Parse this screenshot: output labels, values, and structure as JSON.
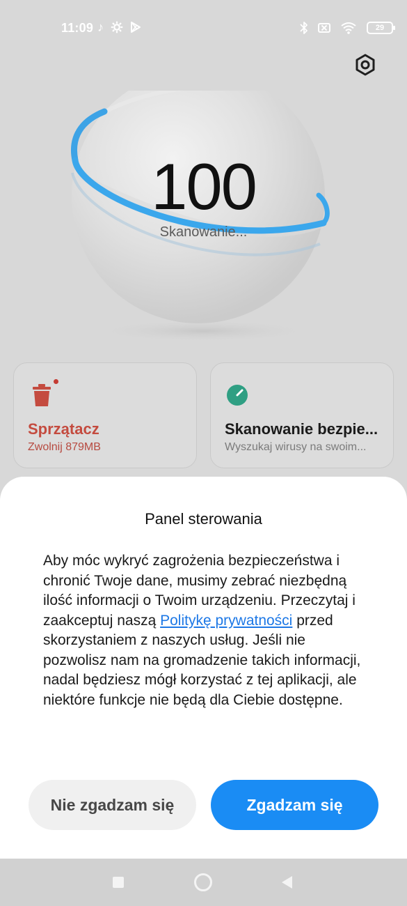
{
  "status_bar": {
    "time": "11:09",
    "left_icons": [
      "tiktok-icon",
      "settings-icon",
      "play-store-icon"
    ],
    "right_icons": [
      "bluetooth-icon",
      "no-sim-icon",
      "wifi-icon"
    ],
    "battery_level": "29"
  },
  "hero": {
    "score": "100",
    "status_text": "Skanowanie..."
  },
  "cards": {
    "cleaner": {
      "icon": "trash-icon",
      "title": "Sprzątacz",
      "subtitle": "Zwolnij 879MB"
    },
    "security_scan": {
      "icon": "security-scan-icon",
      "title": "Skanowanie bezpie...",
      "subtitle": "Wyszukaj wirusy na swoim..."
    }
  },
  "dialog": {
    "title": "Panel sterowania",
    "body_before": "Aby móc wykryć zagrożenia bezpieczeństwa i chronić Twoje dane, musimy zebrać niezbędną ilość informacji o Twoim urządzeniu. Przeczytaj i zaakceptuj naszą ",
    "link_text": "Politykę prywatności",
    "body_after": " przed skorzystaniem z naszych usług. Jeśli nie pozwolisz nam na gromadzenie takich informacji, nadal będziesz mógł korzystać z tej aplikacji, ale niektóre funkcje nie będą dla Ciebie dostępne.",
    "decline_label": "Nie zgadzam się",
    "accept_label": "Zgadzam się"
  },
  "colors": {
    "accent": "#1a8cf4",
    "link": "#1d78e6",
    "cleaner_red": "#c44b3f",
    "scan_green": "#2f9f83"
  },
  "nav_bar": {
    "icons": [
      "recent-apps-icon",
      "home-icon",
      "back-icon"
    ]
  }
}
